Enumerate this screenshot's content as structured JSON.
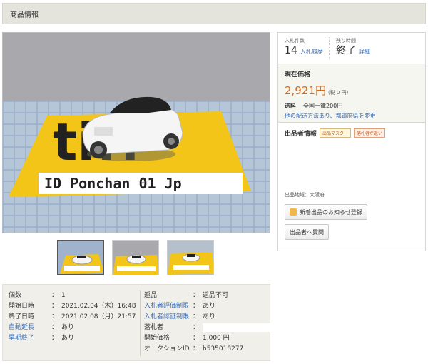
{
  "header": {
    "title": "商品情報"
  },
  "photo": {
    "plate_text": "ID Ponchan 01 Jp",
    "sign_text": "ti!!"
  },
  "thumbnails": [
    {
      "label": ""
    },
    {
      "label": ""
    },
    {
      "label": ""
    }
  ],
  "specs": {
    "left": [
      {
        "label": "個数",
        "value": "1",
        "link": false
      },
      {
        "label": "開始日時",
        "value": "2021.02.04（木）16:48",
        "link": false
      },
      {
        "label": "終了日時",
        "value": "2021.02.08（月）21:57",
        "link": false
      },
      {
        "label": "自動延長",
        "value": "あり",
        "link": true
      },
      {
        "label": "早期終了",
        "value": "あり",
        "link": true
      }
    ],
    "right": [
      {
        "label": "返品",
        "value": "返品不可",
        "link": false
      },
      {
        "label": "入札者評価制限",
        "value": "あり",
        "link": true
      },
      {
        "label": "入札者認証制限",
        "value": "あり",
        "link": true
      },
      {
        "label": "落札者",
        "value": "",
        "link": false,
        "masked": true
      },
      {
        "label": "開始価格",
        "value": "1,000 円",
        "link": false
      },
      {
        "label": "オークションID",
        "value": "h535018277",
        "link": false
      }
    ],
    "separator": "："
  },
  "bid": {
    "count_label": "入札件数",
    "count": "14",
    "history_link": "入札履歴",
    "remaining_label": "残り時間",
    "remaining": "終了",
    "detail_link": "詳細"
  },
  "price": {
    "title": "現在価格",
    "amount": "2,921円",
    "tax": "(税 0 円)",
    "ship_label": "送料",
    "ship_value": "全国一律200円",
    "ship_link": "他の配送方法あり、都道府県を変更"
  },
  "seller": {
    "title": "出品者情報",
    "badge1": "出品マスター",
    "badge2": "落札者が返い",
    "region": "出品地域：大阪府",
    "follow_button": "新着出品のお知らせ登録",
    "question_button": "出品者へ質問"
  },
  "colors": {
    "price": "#d96a18",
    "link": "#3a6eb5",
    "panel_bg": "#f0efea"
  }
}
